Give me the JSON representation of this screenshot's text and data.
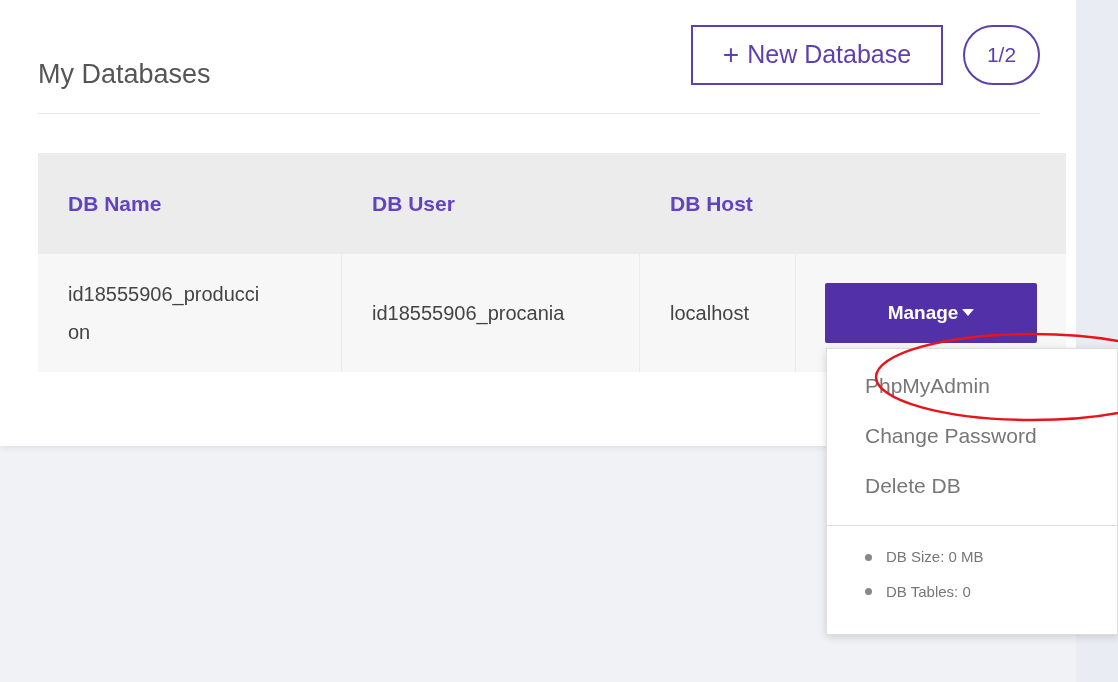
{
  "title": "My Databases",
  "new_button": {
    "icon": "+",
    "label": "New Database"
  },
  "counter": "1/2",
  "table": {
    "columns": [
      "DB Name",
      "DB User",
      "DB Host"
    ],
    "rows": [
      {
        "cells": [
          "id18555906_produccion",
          "id18555906_procania",
          "localhost"
        ],
        "action": "Manage"
      }
    ]
  },
  "dropdown": {
    "items": [
      {
        "label": "PhpMyAdmin",
        "highlighted": true
      },
      {
        "label": "Change Password",
        "highlighted": false
      },
      {
        "label": "Delete DB",
        "highlighted": false
      }
    ],
    "info": [
      "DB Size: 0 MB",
      "DB Tables: 0"
    ]
  }
}
